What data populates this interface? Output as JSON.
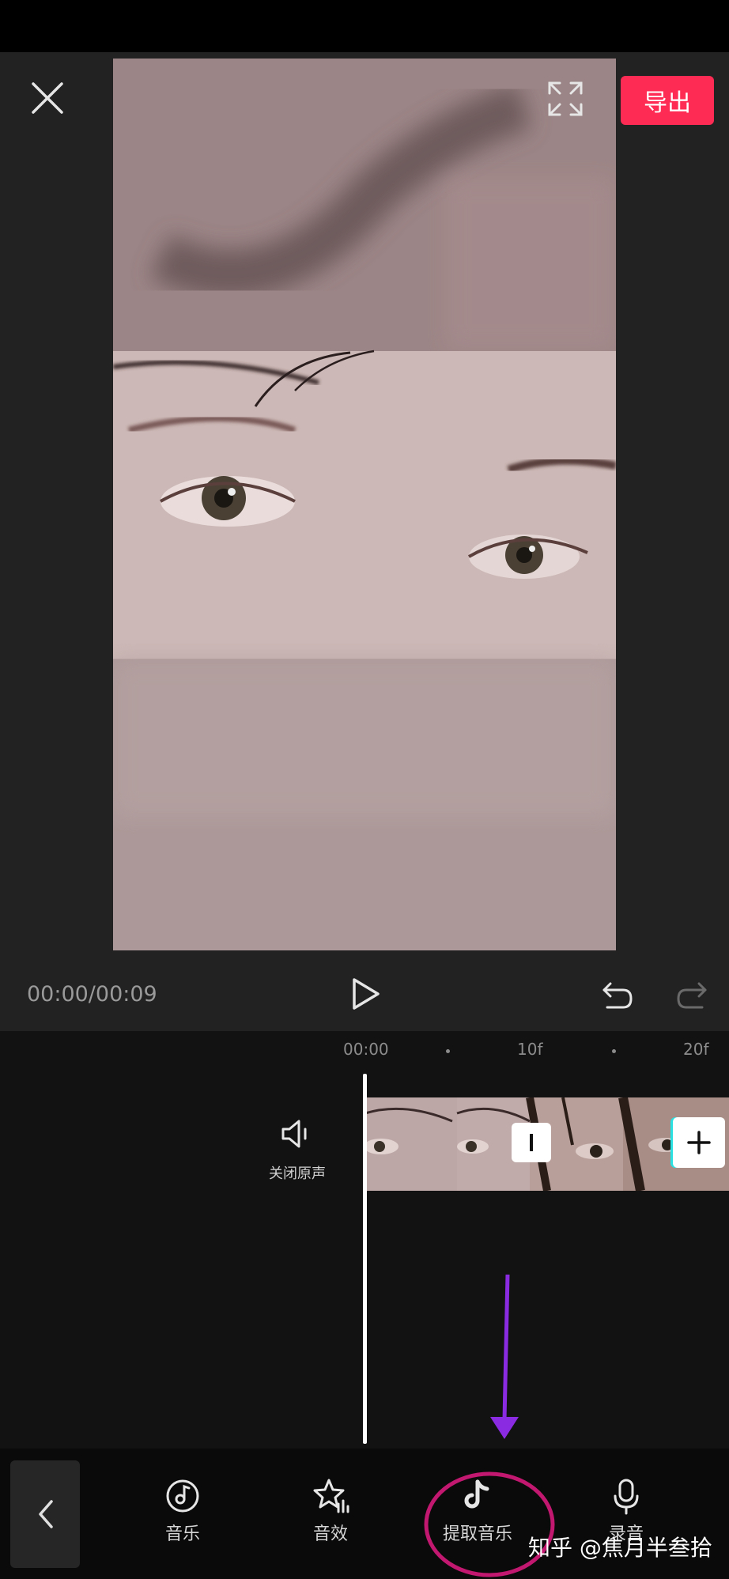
{
  "header": {
    "export_label": "导出"
  },
  "player": {
    "time": "00:00/00:09"
  },
  "timeline": {
    "ruler": [
      "00:00",
      "10f",
      "20f"
    ],
    "mute_label": "关闭原声"
  },
  "toolbar": {
    "items": [
      {
        "label": "音乐",
        "icon": "music-disc-icon"
      },
      {
        "label": "音效",
        "icon": "star-sound-effect-icon"
      },
      {
        "label": "提取音乐",
        "icon": "tiktok-note-icon"
      },
      {
        "label": "录音",
        "icon": "microphone-icon"
      }
    ]
  },
  "watermark": "知乎 @焦月半叁拾",
  "colors": {
    "accent": "#fe2c55",
    "annotation_arrow": "#8a2be2",
    "annotation_circle": "#c2186f"
  }
}
